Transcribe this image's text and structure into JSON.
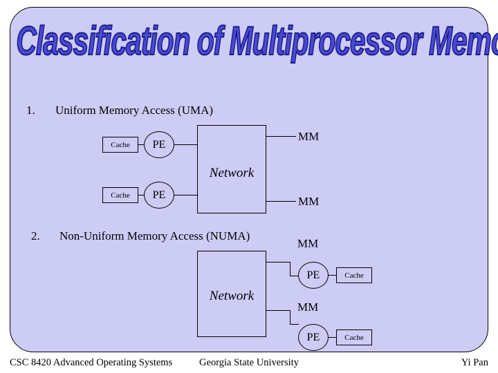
{
  "slide": {
    "title": "Classification of Multiprocessor Memory",
    "title_color": "#4a4ad0",
    "panel_color": "#ccccf5"
  },
  "items": [
    {
      "number": "1.",
      "text": "Uniform Memory Access (UMA)"
    },
    {
      "number": "2.",
      "text": "Non-Uniform Memory Access (NUMA)"
    }
  ],
  "uma": {
    "network_label": "Network",
    "cache_top": "Cache",
    "cache_bottom": "Cache",
    "pe_top": "PE",
    "pe_bottom": "PE",
    "mm_top": "MM",
    "mm_bottom": "MM"
  },
  "numa": {
    "network_label": "Network",
    "mm_top": "MM",
    "mm_bottom": "MM",
    "pe_top": "PE",
    "pe_bottom": "PE",
    "cache_top": "Cache",
    "cache_bottom": "Cache"
  },
  "footer": {
    "left": "CSC 8420 Advanced Operating Systems",
    "center": "Georgia State University",
    "right": "Yi Pan"
  }
}
